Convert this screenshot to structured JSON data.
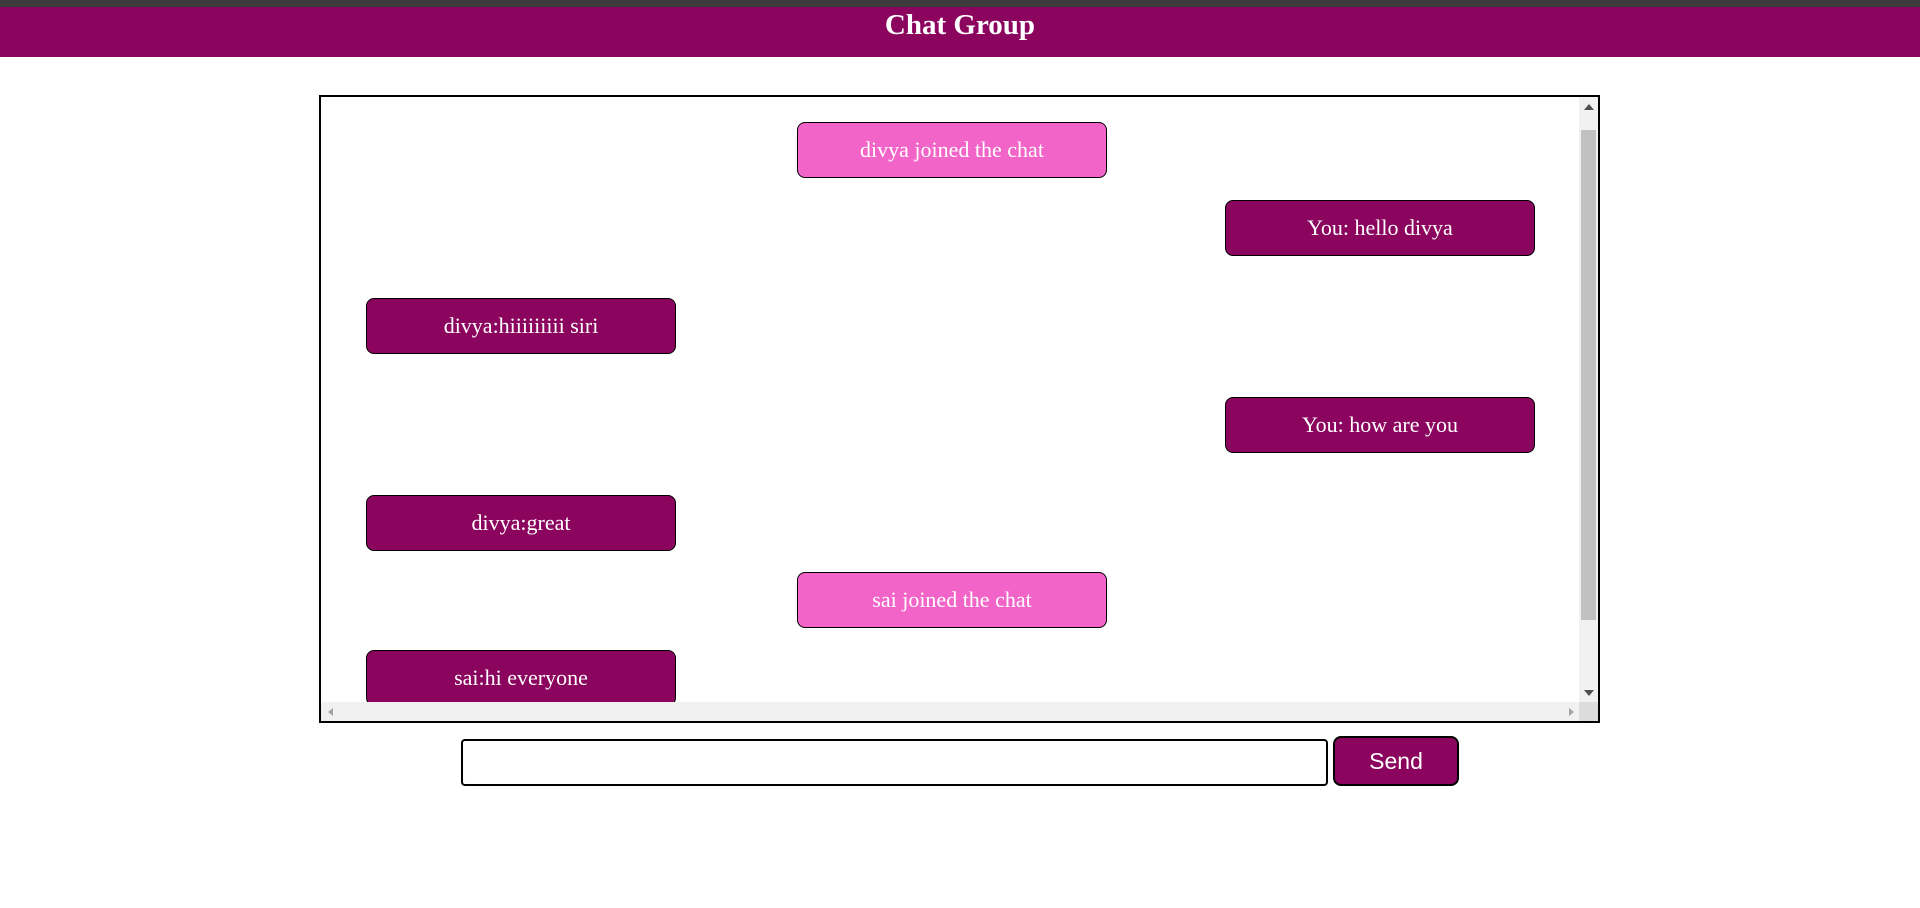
{
  "header": {
    "title": "Chat Group"
  },
  "chat": {
    "messages": [
      {
        "type": "system",
        "align": "center",
        "text": "divya joined the chat"
      },
      {
        "type": "user",
        "align": "right",
        "text": "You: hello divya"
      },
      {
        "type": "user",
        "align": "left",
        "text": "divya:hiiiiiiiii siri"
      },
      {
        "type": "user",
        "align": "right",
        "text": "You: how are you"
      },
      {
        "type": "user",
        "align": "left",
        "text": "divya:great"
      },
      {
        "type": "system",
        "align": "center",
        "text": "sai joined the chat"
      },
      {
        "type": "user",
        "align": "left",
        "text": "sai:hi everyone"
      }
    ]
  },
  "composer": {
    "input_value": "",
    "placeholder": "",
    "send_label": "Send"
  },
  "colors": {
    "header_bg": "#8b055f",
    "user_bubble": "#8b055f",
    "system_bubble": "#f264c8",
    "text": "#ffffff"
  }
}
